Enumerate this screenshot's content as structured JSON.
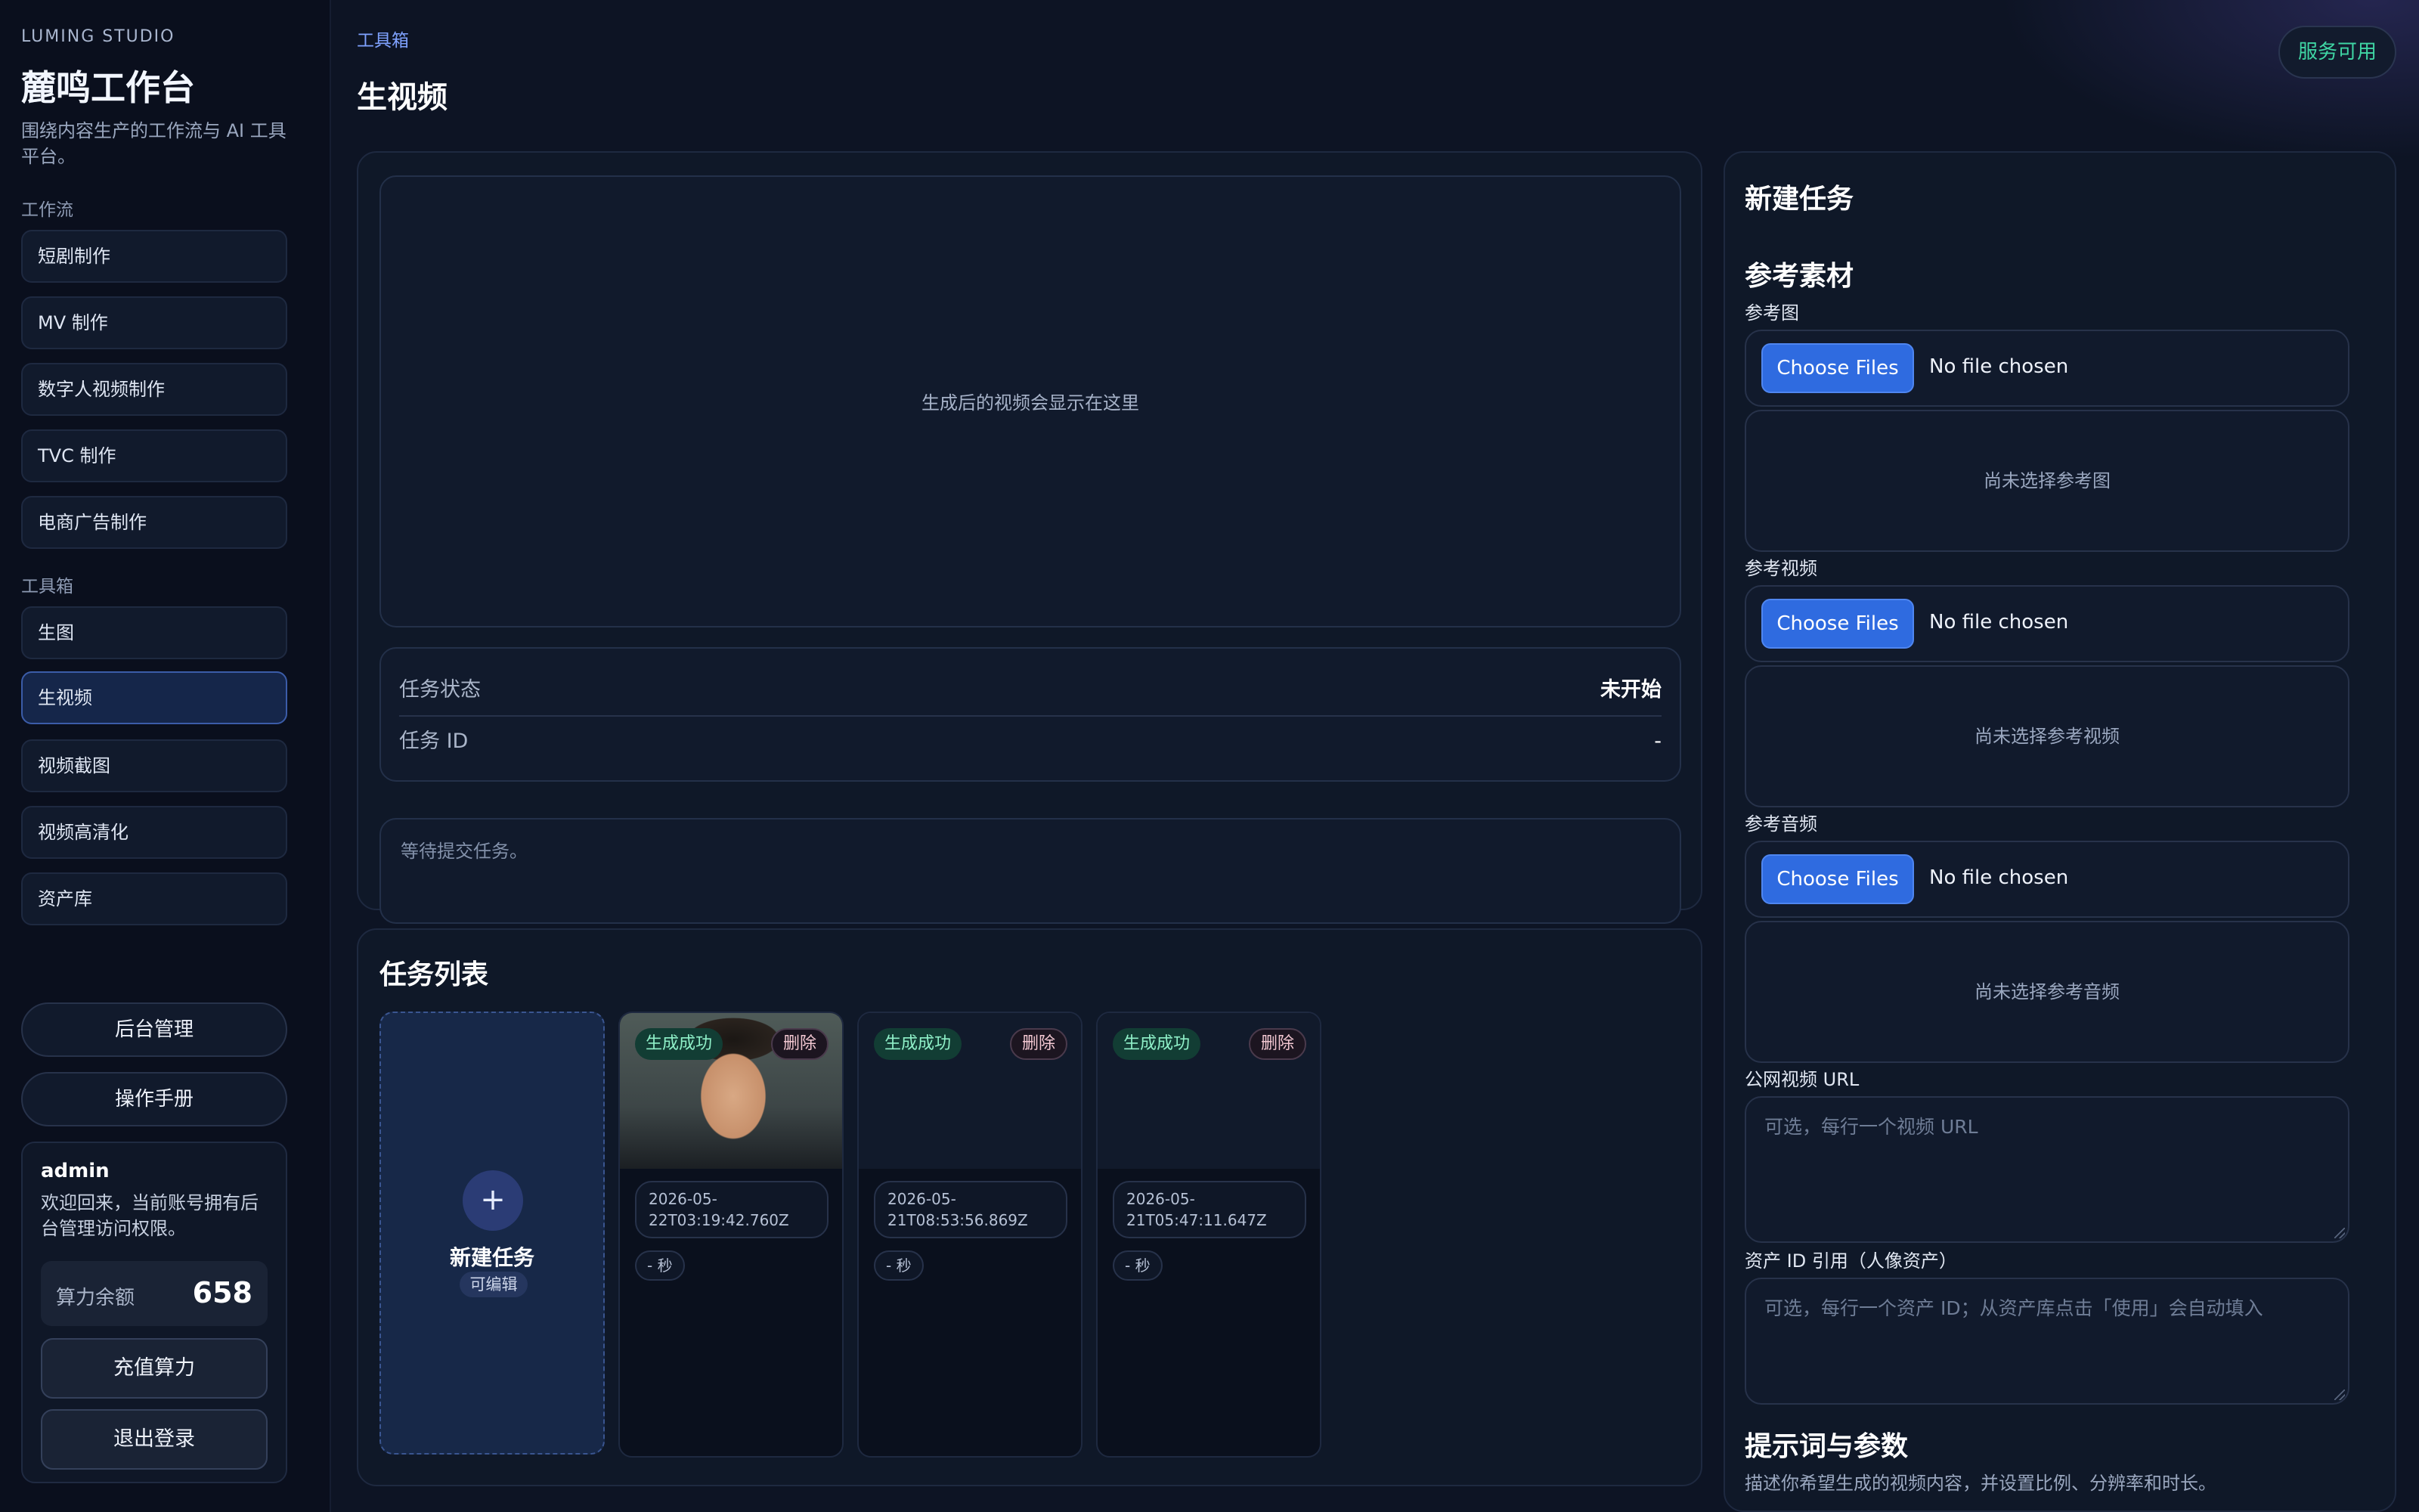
{
  "sidebar": {
    "brand_kicker": "LUMING STUDIO",
    "brand_title": "麓鸣工作台",
    "brand_desc": "围绕内容生产的工作流与 AI 工具平台。",
    "workflow_label": "工作流",
    "workflow_items": [
      "短剧制作",
      "MV 制作",
      "数字人视频制作",
      "TVC 制作",
      "电商广告制作"
    ],
    "toolbox_label": "工具箱",
    "toolbox_items": [
      "生图",
      "生视频",
      "视频截图",
      "视频高清化",
      "资产库"
    ],
    "active_item": "生视频",
    "admin_button": "后台管理",
    "manual_button": "操作手册",
    "user": {
      "name": "admin",
      "desc": "欢迎回来，当前账号拥有后台管理访问权限。",
      "balance_label": "算力余额",
      "balance_value": "658",
      "recharge_button": "充值算力",
      "logout_button": "退出登录"
    }
  },
  "header": {
    "breadcrumb": "工具箱",
    "title": "生视频",
    "service_status": "服务可用",
    "service_status_color": "#3fd6a4"
  },
  "preview": {
    "placeholder": "生成后的视频会显示在这里"
  },
  "task_info": {
    "status_label": "任务状态",
    "status_value": "未开始",
    "id_label": "任务 ID",
    "id_value": "-"
  },
  "log": {
    "text": "等待提交任务。"
  },
  "task_list": {
    "title": "任务列表",
    "new_task_label": "新建任务",
    "new_task_tag": "可编辑",
    "new_task_icon": "plus-icon",
    "tasks": [
      {
        "status": "生成成功",
        "delete": "删除",
        "date_line1": "2026-05-",
        "date_line2": "22T03:19:42.760Z",
        "duration": "- 秒",
        "has_thumb": true
      },
      {
        "status": "生成成功",
        "delete": "删除",
        "date_line1": "2026-05-",
        "date_line2": "21T08:53:56.869Z",
        "duration": "- 秒",
        "has_thumb": false
      },
      {
        "status": "生成成功",
        "delete": "删除",
        "date_line1": "2026-05-",
        "date_line2": "21T05:47:11.647Z",
        "duration": "- 秒",
        "has_thumb": false
      }
    ]
  },
  "new_task": {
    "title": "新建任务",
    "ref_section": "参考素材",
    "ref_image_label": "参考图",
    "ref_video_label": "参考视频",
    "ref_audio_label": "参考音频",
    "choose_files": "Choose Files",
    "no_file": "No file chosen",
    "ref_image_empty": "尚未选择参考图",
    "ref_video_empty": "尚未选择参考视频",
    "ref_audio_empty": "尚未选择参考音频",
    "video_url_label": "公网视频 URL",
    "video_url_placeholder": "可选，每行一个视频 URL",
    "asset_id_label": "资产 ID 引用（人像资产）",
    "asset_id_placeholder": "可选，每行一个资产 ID；从资产库点击「使用」会自动填入",
    "prompt_section": "提示词与参数",
    "prompt_desc": "描述你希望生成的视频内容，并设置比例、分辨率和时长。"
  }
}
